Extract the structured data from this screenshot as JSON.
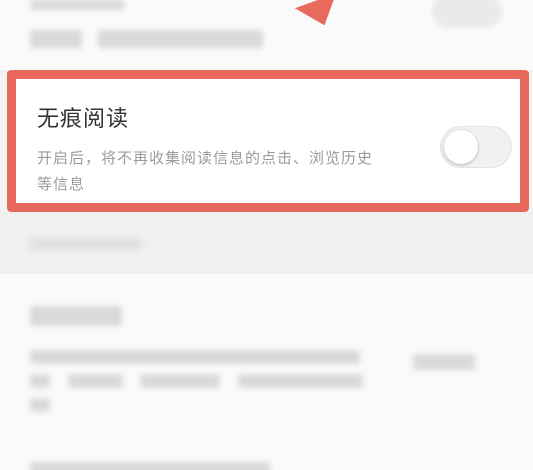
{
  "private_reading": {
    "title": "无痕阅读",
    "description": "开启后，将不再收集阅读信息的点击、浏览历史等信息",
    "toggle_on": false
  },
  "colors": {
    "highlight": "#e8695c",
    "title": "#333333",
    "description": "#9b9b9b"
  },
  "icons": {
    "arrow": "arrow-down-right-icon"
  }
}
